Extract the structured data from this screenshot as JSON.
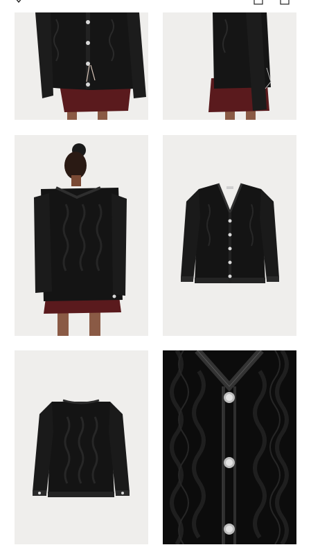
{
  "colors": {
    "background": "#ffffff",
    "photo_bg": "#efeeec",
    "garment": "#141414",
    "skirt": "#5a1a1d",
    "button": "#d8d8d8"
  },
  "topbar": {
    "icons": [
      "back-icon",
      "bag-icon",
      "share-icon"
    ]
  },
  "gallery": {
    "images": [
      {
        "name": "product-photo-front-closeup"
      },
      {
        "name": "product-photo-side-view"
      },
      {
        "name": "product-photo-back-view"
      },
      {
        "name": "product-photo-flat-front"
      },
      {
        "name": "product-photo-flat-back"
      },
      {
        "name": "product-photo-knit-detail"
      }
    ]
  }
}
